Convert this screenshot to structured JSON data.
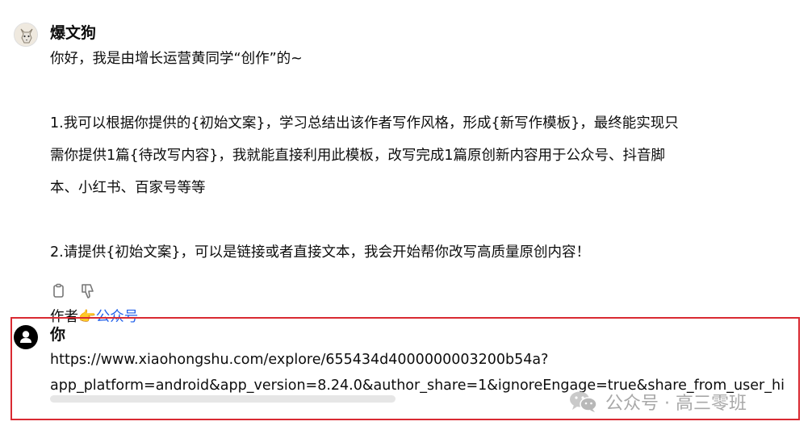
{
  "bot": {
    "name": "爆文狗",
    "avatar_icon": "dog-avatar-icon",
    "message_lines": [
      "你好，我是由增长运营黄同学“创作”的~",
      "",
      "1.我可以根据你提供的{初始文案}，学习总结出该作者写作风格，形成{新写作模板}，最终能实现只",
      "需你提供1篇{待改写内容}，我就能直接利用此模板，改写完成1篇原创新内容用于公众号、抖音脚",
      "本、小红书、百家号等等",
      "",
      "2.请提供{初始文案}，可以是链接或者直接文本，我会开始帮你改写高质量原创内容！",
      ""
    ],
    "author_prefix": "作者",
    "author_emoji": "👉",
    "author_link": "公众号",
    "actions": [
      "copy-icon",
      "thumbs-down-icon"
    ]
  },
  "user": {
    "name": "你",
    "avatar_icon": "user-avatar-icon",
    "message_line1": "https://www.xiaohongshu.com/explore/655434d4000000003200b54a?",
    "message_line2": "app_platform=android&app_version=8.24.0&author_share=1&ignoreEngage=true&share_from_user_hi"
  },
  "watermark": {
    "text": "公众号 · 高三零班",
    "icon": "wechat-icon"
  },
  "colors": {
    "highlight_border": "#d92a32",
    "link": "#2463eb",
    "text": "#0d0d0d"
  }
}
